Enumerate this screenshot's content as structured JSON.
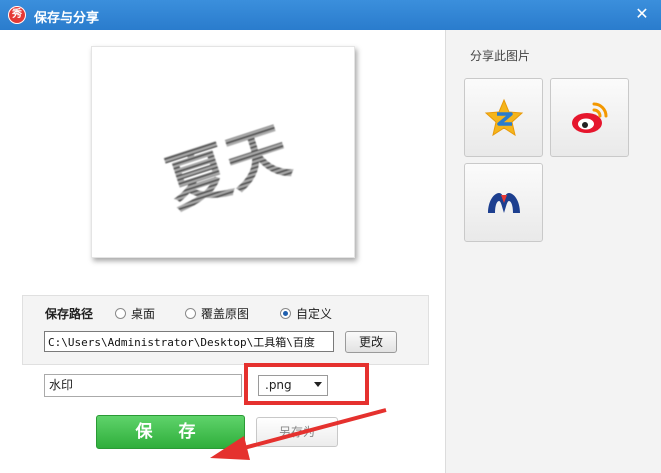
{
  "window": {
    "title": "保存与分享",
    "app_icon_text": "秀",
    "close_glyph": "✕"
  },
  "preview": {
    "image_text": "夏天"
  },
  "save_options": {
    "path_label": "保存路径",
    "radio_options": [
      {
        "label": "桌面",
        "selected": false
      },
      {
        "label": "覆盖原图",
        "selected": false
      },
      {
        "label": "自定义",
        "selected": true
      }
    ],
    "path_value": "C:\\Users\\Administrator\\Desktop\\工具箱\\百度",
    "change_button_label": "更改"
  },
  "watermark": {
    "value": "水印"
  },
  "format": {
    "selected": ".png"
  },
  "actions": {
    "save_label": "保 存",
    "save_as_label": "另存为"
  },
  "share": {
    "title": "分享此图片",
    "targets": [
      {
        "name": "qzone-icon"
      },
      {
        "name": "weibo-icon"
      },
      {
        "name": "renren-icon"
      }
    ]
  },
  "colors": {
    "titlebar": "#2a7ccd",
    "accent_green": "#2fae3b",
    "annotation_red": "#e5312e"
  }
}
